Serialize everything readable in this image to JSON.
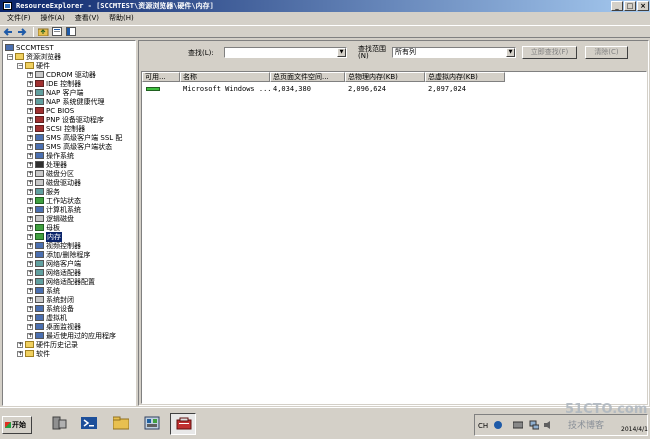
{
  "window": {
    "title": "ResourceExplorer - [SCCMTEST\\资源浏览器\\硬件\\内存]",
    "minimize": "_",
    "maximize": "□",
    "close": "×"
  },
  "menu": [
    "文件(F)",
    "操作(A)",
    "查看(V)",
    "帮助(H)"
  ],
  "toolbar_icons": [
    "back-arrow-icon",
    "forward-arrow-icon",
    "folder-up-icon",
    "properties-icon",
    "help-icon"
  ],
  "tree": {
    "root": "SCCMTEST",
    "browser": "资源浏览器",
    "hardware": "硬件",
    "items": [
      "CDROM 驱动器",
      "IDE 控制器",
      "NAP 客户端",
      "NAP 系统健康代理",
      "PC BIOS",
      "PNP 设备驱动程序",
      "SCSI 控制器",
      "SMS 高级客户端 SSL 配",
      "SMS 高级客户端状态",
      "操作系统",
      "处理器",
      "磁盘分区",
      "磁盘驱动器",
      "服务",
      "工作站状态",
      "计算机系统",
      "逻辑磁盘",
      "母板",
      "内存",
      "视频控制器",
      "添加/删除程序",
      "网络客户端",
      "网络适配器",
      "网络适配器配置",
      "系统",
      "系统封闭",
      "系统设备",
      "虚拟机",
      "桌面监视器",
      "最近使用过的应用程序"
    ],
    "selected": "内存",
    "history": "硬件历史记录",
    "software": "软件"
  },
  "search": {
    "find_label": "查找(L):",
    "find_value": "",
    "range_label_line1": "查找范围",
    "range_label_line2": "(N)",
    "range_value": "所有列",
    "find_now": "立即查找(F)",
    "clear": "清除(C)"
  },
  "list": {
    "columns": [
      "可用...",
      "名称",
      "总页面文件空间...",
      "总物理内存(KB)",
      "总虚拟内存(KB)"
    ],
    "rows": [
      {
        "available": "",
        "name": "Microsoft Windows ...",
        "page_file": "4,034,380",
        "physical": "2,096,624",
        "virtual": "2,097,024"
      }
    ]
  },
  "taskbar": {
    "start": "开始",
    "apps": [
      "server-manager-icon",
      "powershell-icon",
      "explorer-icon",
      "configuration-manager-icon",
      "resource-explorer-icon"
    ],
    "lang": "CH",
    "clock": "2014/4/1"
  },
  "watermark": {
    "line1": "51CTO.com",
    "line2": "技术博客"
  }
}
